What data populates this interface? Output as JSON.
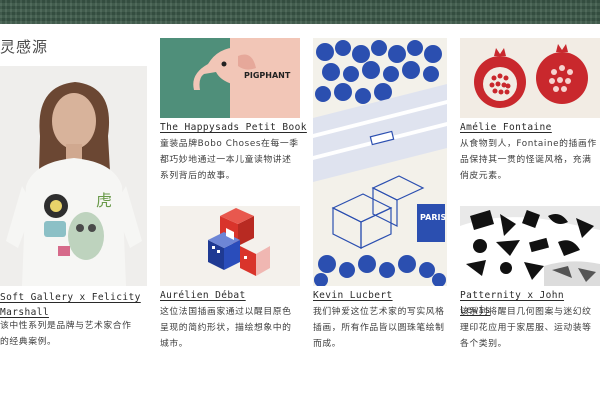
{
  "section": {
    "title": "灵感源"
  },
  "cards": [
    {
      "title": "Soft Gallery x Felicity Marshall",
      "description": "该中性系列是品牌与艺术家合作的经典案例。",
      "image": "girl-in-white-tshirt-photo",
      "image_text": "虎"
    },
    {
      "title": "The Happysads Petit Book",
      "description": "童装品牌Bobo Choses在每一季都巧妙地通过一本儿童读物讲述系列背后的故事。",
      "image": "elephant-illustration",
      "image_text": "PIGPHANT"
    },
    {
      "title": "Aurélien Débat",
      "description": "这位法国插画家通过以醒目原色呈现的简约形状，描绘想象中的城市。",
      "image": "isometric-city-illustration"
    },
    {
      "title": "Kevin Lucbert",
      "description": "我们钟爱这位艺术家的写实风格插画，所有作品皆以圆珠笔绘制而成。",
      "image": "blue-ballpoint-city-illustration",
      "image_text": "PARIS 2024"
    },
    {
      "title": "Amélie Fontaine",
      "description": "从食物到人，Fontaine的插画作品保持其一贯的怪诞风格，充满俏皮元素。",
      "image": "pomegranate-illustration"
    },
    {
      "title": "Patternity x John Lewis",
      "description": "该系列将醒目几何图案与迷幻纹理印花应用于家居服、运动装等各个类别。",
      "image": "geometric-pattern-cushions"
    }
  ],
  "colors": {
    "band": "#3b5848",
    "text": "#333333",
    "elephant_bg_left": "#4f8f7a",
    "elephant_bg_right": "#f2c6b7",
    "primary_blue": "#1f3a93",
    "primary_red": "#d9342b",
    "pomegranate_red": "#c9282d"
  }
}
